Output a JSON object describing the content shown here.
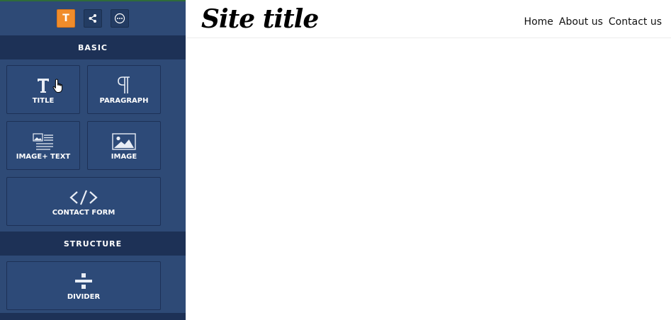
{
  "sidebar": {
    "toolbar": [
      {
        "icon": "text-icon",
        "glyph": "T",
        "active": true
      },
      {
        "icon": "share-icon",
        "active": false
      },
      {
        "icon": "more-icon",
        "active": false
      }
    ],
    "sections": {
      "basic": {
        "title": "BASIC",
        "blocks": [
          {
            "label": "TITLE",
            "icon": "title-icon"
          },
          {
            "label": "PARAGRAPH",
            "icon": "paragraph-icon"
          },
          {
            "label": "IMAGE+ TEXT",
            "icon": "image-text-icon"
          },
          {
            "label": "IMAGE",
            "icon": "image-icon"
          },
          {
            "label": "CONTACT FORM",
            "icon": "code-icon"
          }
        ]
      },
      "structure": {
        "title": "STRUCTURE",
        "blocks": [
          {
            "label": "DIVIDER",
            "icon": "divider-icon"
          }
        ]
      }
    }
  },
  "site": {
    "title": "Site title",
    "nav": [
      "Home",
      "About us",
      "Contact us"
    ]
  },
  "colors": {
    "sidebar_bg": "#2e4a76",
    "section_header_bg": "#1d3156",
    "active_tool": "#f08c2b"
  }
}
